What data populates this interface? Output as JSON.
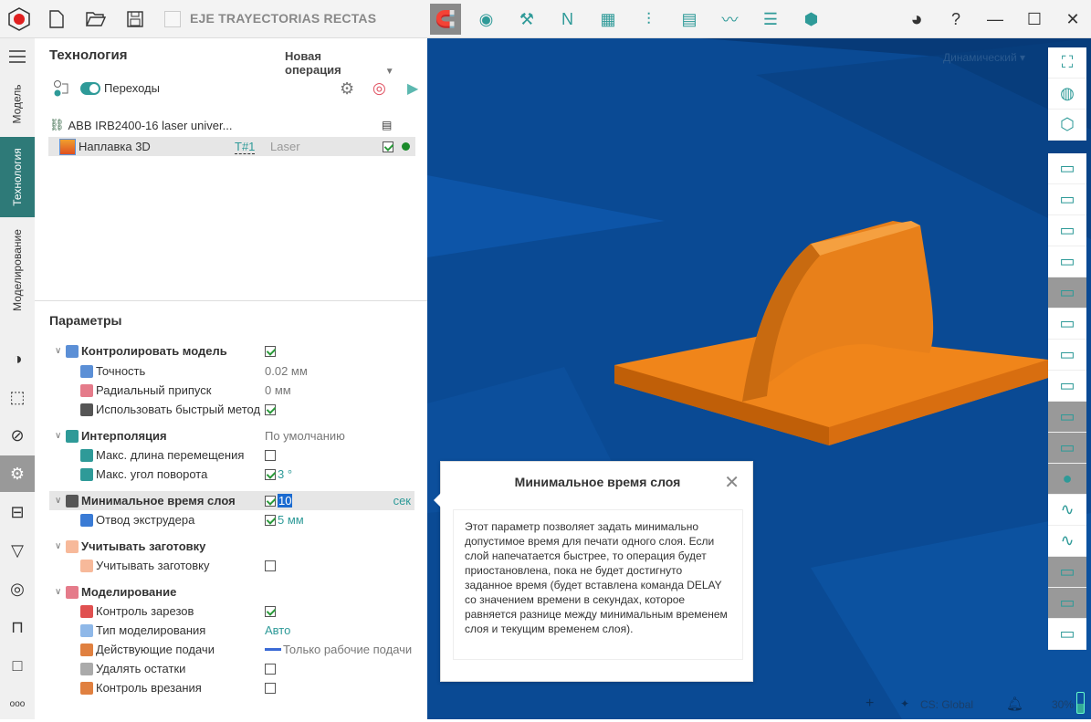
{
  "toolbar": {
    "project_title": "EJE TRAYECTORIAS RECTAS",
    "left_icons": [
      "app-logo-icon",
      "new-file-icon",
      "open-folder-icon",
      "save-icon"
    ],
    "tools": [
      "magnet-icon",
      "simulation-icon",
      "machine-icon",
      "nc-icon",
      "report-icon",
      "tools-icon",
      "postprocessor-icon",
      "chart-icon",
      "layers-icon",
      "part-icon"
    ],
    "right": [
      "assistant-avatar-icon",
      "help-icon",
      "minimize-icon",
      "maximize-icon",
      "close-icon"
    ]
  },
  "rail": {
    "tabs": [
      "Модель",
      "Технология",
      "Моделирование"
    ],
    "active_tab": "Технология",
    "icons": [
      "shading-icon",
      "selection-icon",
      "compass-icon",
      "settings-icon",
      "align-icon",
      "tool-icon",
      "gauge-icon",
      "fixture-icon",
      "stock-icon",
      "more-icon"
    ]
  },
  "panel": {
    "title": "Технология",
    "new_operation": "Новая операция",
    "transitions_label": "Переходы",
    "transitions_on": true,
    "tree": {
      "robot": "ABB IRB2400-16 laser univer...",
      "operation": "Наплавка 3D",
      "tool": "T#1",
      "tool_type": "Laser"
    },
    "params_title": "Параметры",
    "params": [
      {
        "label": "Контролировать модель",
        "group": true,
        "checked": true,
        "icon": "#5b8fd6"
      },
      {
        "label": "Точность",
        "value": "0.02 мм",
        "icon": "#5b8fd6"
      },
      {
        "label": "Радиальный припуск",
        "value": "0 мм",
        "icon": "#e57b8a"
      },
      {
        "label": "Использовать быстрый метод",
        "checked": true,
        "icon": "#555",
        "inline": true
      },
      {
        "label": "Интерполяция",
        "group": true,
        "value": "По умолчанию",
        "icon": "#2e9a98"
      },
      {
        "label": "Макс. длина перемещения",
        "checked": false,
        "icon": "#2e9a98"
      },
      {
        "label": "Макс. угол поворота",
        "checked": true,
        "value": "3 °",
        "teal": true,
        "icon": "#2e9a98"
      },
      {
        "label": "Минимальное время слоя",
        "group": true,
        "checked": true,
        "value": "10",
        "unit": "сек",
        "selected": true,
        "icon": "#555"
      },
      {
        "label": "Отвод экструдера",
        "checked": true,
        "value": "5 мм",
        "teal": true,
        "icon": "#3a7bd5"
      },
      {
        "label": "Учитывать заготовку",
        "group": true,
        "icon": "#f7b99a"
      },
      {
        "label": "Учитывать заготовку",
        "checked": false,
        "icon": "#f7b99a"
      },
      {
        "label": "Моделирование",
        "group": true,
        "icon": "#e57b8a"
      },
      {
        "label": "Контроль зарезов",
        "checked": true,
        "icon": "#e05050"
      },
      {
        "label": "Тип моделирования",
        "value": "Авто",
        "teal": true,
        "icon": "#8fb8e8"
      },
      {
        "label": "Действующие подачи",
        "value": "Только рабочие подачи",
        "line": true,
        "icon": "#e08040"
      },
      {
        "label": "Удалять остатки",
        "checked": false,
        "icon": "#aaa"
      },
      {
        "label": "Контроль врезания",
        "checked": false,
        "icon": "#e08040"
      }
    ]
  },
  "viewport": {
    "view_mode": "Динамический",
    "coord_system": "CS: Global",
    "zoom": "30%"
  },
  "tooltip": {
    "title": "Минимальное время слоя",
    "text": "Этот параметр позволяет задать минимально допустимое время для печати одного слоя. Если слой напечатается быстрее, то операция будет приостановлена, пока не будет достигнуто заданное время (будет вставлена команда DELAY со значением времени в секундах, которое равняется разнице между минимальным временем слоя и текущим временем слоя)."
  },
  "colors": {
    "accent": "#2e7a78",
    "viewport": "#0a4a94",
    "part": "#f0851a"
  }
}
